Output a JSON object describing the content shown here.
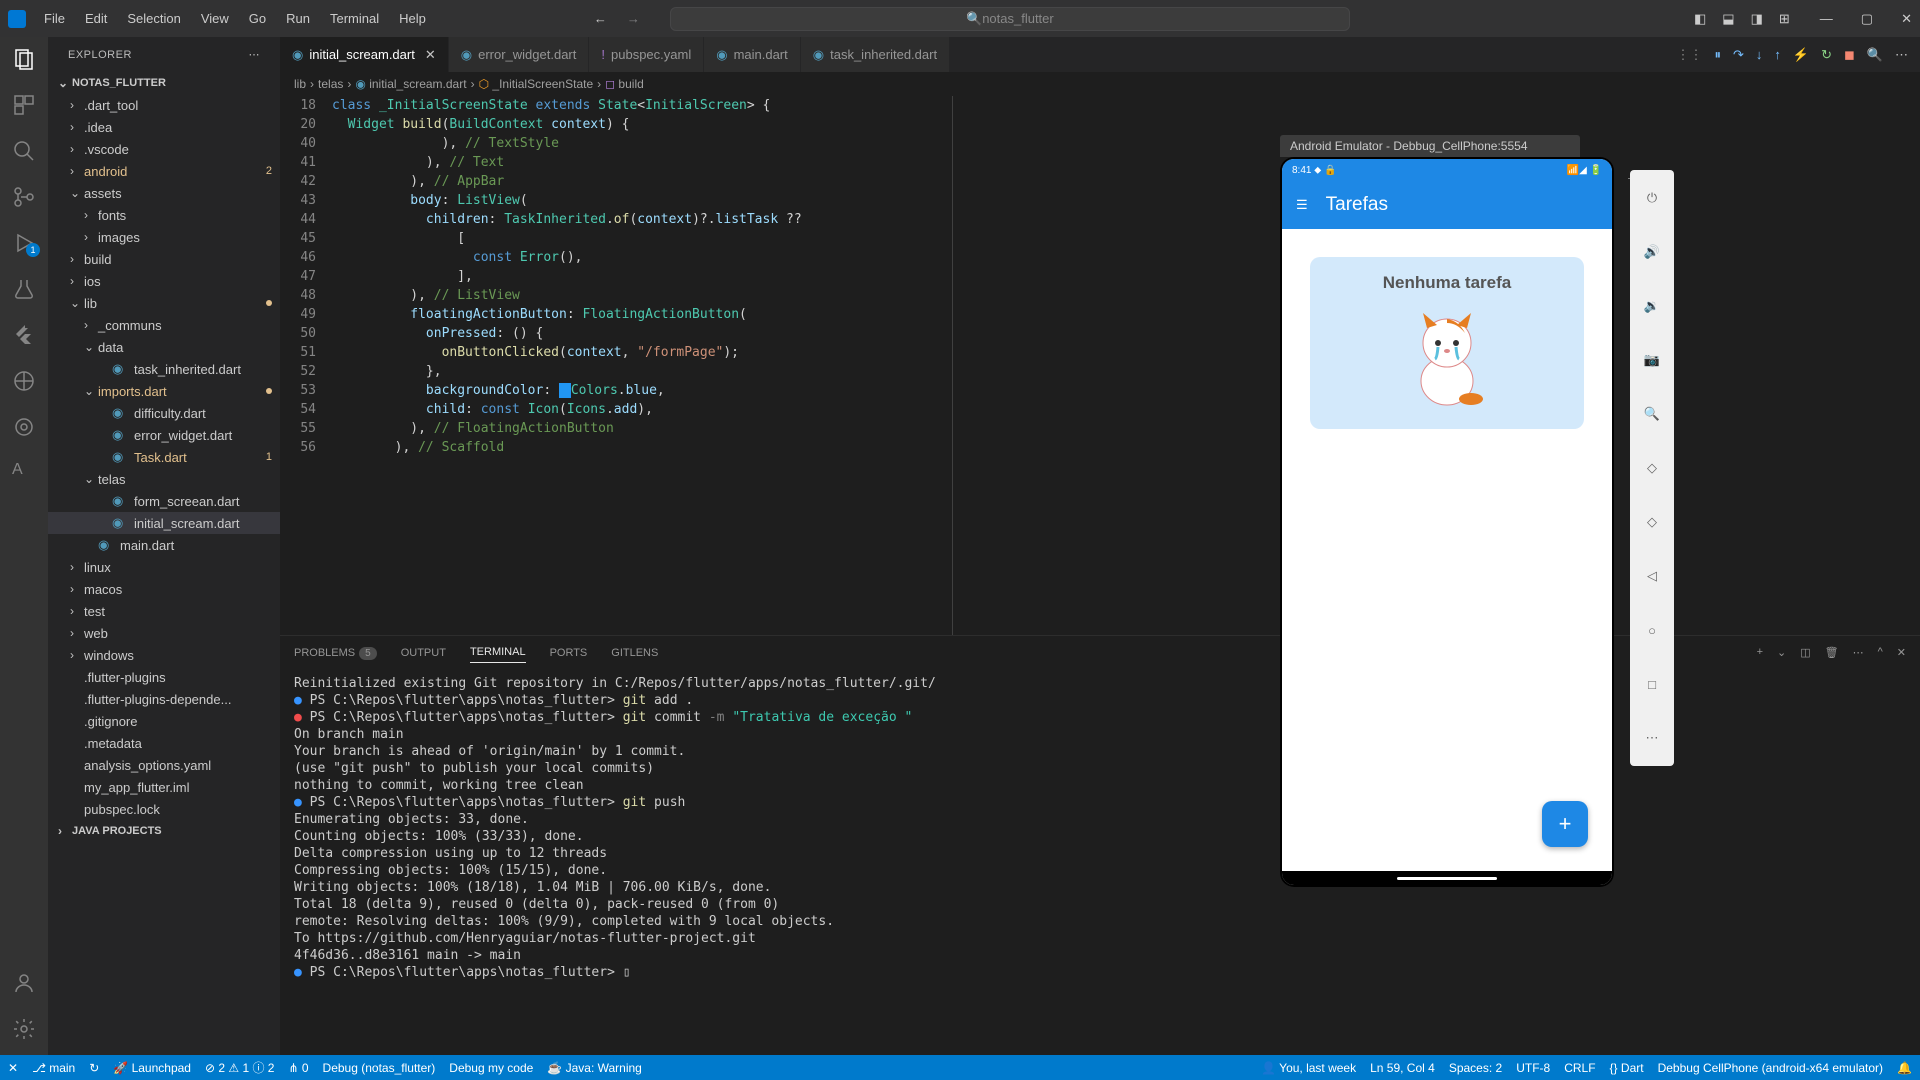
{
  "titlebar": {
    "menu": [
      "File",
      "Edit",
      "Selection",
      "View",
      "Go",
      "Run",
      "Terminal",
      "Help"
    ],
    "search": "notas_flutter"
  },
  "sidebar": {
    "title": "EXPLORER",
    "root": "NOTAS_FLUTTER",
    "items": [
      {
        "label": ".dart_tool",
        "chev": "›",
        "indent": 1
      },
      {
        "label": ".idea",
        "chev": "›",
        "indent": 1
      },
      {
        "label": ".vscode",
        "chev": "›",
        "indent": 1
      },
      {
        "label": "android",
        "chev": "›",
        "indent": 1,
        "mod": true,
        "badge": "2"
      },
      {
        "label": "assets",
        "chev": "⌄",
        "indent": 1
      },
      {
        "label": "fonts",
        "chev": "›",
        "indent": 2
      },
      {
        "label": "images",
        "chev": "›",
        "indent": 2
      },
      {
        "label": "build",
        "chev": "›",
        "indent": 1
      },
      {
        "label": "ios",
        "chev": "›",
        "indent": 1
      },
      {
        "label": "lib",
        "chev": "⌄",
        "indent": 1,
        "dot": true
      },
      {
        "label": "_communs",
        "chev": "›",
        "indent": 2
      },
      {
        "label": "data",
        "chev": "⌄",
        "indent": 2
      },
      {
        "label": "task_inherited.dart",
        "icon": "◉",
        "indent": 3
      },
      {
        "label": "imports.dart",
        "chev": "⌄",
        "indent": 2,
        "mod": true,
        "dot": true
      },
      {
        "label": "difficulty.dart",
        "icon": "◉",
        "indent": 3
      },
      {
        "label": "error_widget.dart",
        "icon": "◉",
        "indent": 3
      },
      {
        "label": "Task.dart",
        "icon": "◉",
        "indent": 3,
        "mod": true,
        "badge": "1"
      },
      {
        "label": "telas",
        "chev": "⌄",
        "indent": 2
      },
      {
        "label": "form_screean.dart",
        "icon": "◉",
        "indent": 3
      },
      {
        "label": "initial_scream.dart",
        "icon": "◉",
        "indent": 3,
        "selected": true
      },
      {
        "label": "main.dart",
        "icon": "◉",
        "indent": 2
      },
      {
        "label": "linux",
        "chev": "›",
        "indent": 1
      },
      {
        "label": "macos",
        "chev": "›",
        "indent": 1
      },
      {
        "label": "test",
        "chev": "›",
        "indent": 1
      },
      {
        "label": "web",
        "chev": "›",
        "indent": 1
      },
      {
        "label": "windows",
        "chev": "›",
        "indent": 1
      },
      {
        "label": ".flutter-plugins",
        "icon": "",
        "indent": 1
      },
      {
        "label": ".flutter-plugins-depende...",
        "icon": "",
        "indent": 1
      },
      {
        "label": ".gitignore",
        "icon": "",
        "indent": 1
      },
      {
        "label": ".metadata",
        "icon": "",
        "indent": 1
      },
      {
        "label": "analysis_options.yaml",
        "icon": "",
        "indent": 1
      },
      {
        "label": "my_app_flutter.iml",
        "icon": "",
        "indent": 1
      },
      {
        "label": "pubspec.lock",
        "icon": "",
        "indent": 1
      }
    ],
    "bottom_section": "JAVA PROJECTS"
  },
  "tabs": [
    {
      "label": "initial_scream.dart",
      "active": true,
      "color": "#519aba"
    },
    {
      "label": "error_widget.dart",
      "color": "#519aba"
    },
    {
      "label": "pubspec.yaml",
      "color": "#a074c4",
      "dot": true
    },
    {
      "label": "main.dart",
      "color": "#519aba"
    },
    {
      "label": "task_inherited.dart",
      "color": "#519aba"
    }
  ],
  "breadcrumb": [
    "lib",
    "telas",
    "initial_scream.dart",
    "_InitialScreenState",
    "build"
  ],
  "gutter": [
    "18",
    "20",
    "40",
    "41",
    "42",
    "43",
    "44",
    "45",
    "46",
    "47",
    "48",
    "49",
    "50",
    "51",
    "52",
    "53",
    "54",
    "55",
    "56"
  ],
  "code_lines": [
    "<span class='kw'>class</span> <span class='cls'>_InitialScreenState</span> <span class='kw'>extends</span> <span class='cls'>State</span><span class='pun'>&lt;</span><span class='cls'>InitialScreen</span><span class='pun'>&gt; {</span>",
    "  <span class='cls'>Widget</span> <span class='fn'>build</span><span class='pun'>(</span><span class='cls'>BuildContext</span> <span class='var'>context</span><span class='pun'>) {</span>",
    "              <span class='pun'>),</span> <span class='cmt'>// TextStyle</span>",
    "            <span class='pun'>),</span> <span class='cmt'>// Text</span>",
    "          <span class='pun'>),</span> <span class='cmt'>// AppBar</span>",
    "          <span class='var'>body</span><span class='pun'>:</span> <span class='cls'>ListView</span><span class='pun'>(</span>",
    "            <span class='var'>children</span><span class='pun'>:</span> <span class='cls'>TaskInherited</span><span class='pun'>.</span><span class='fn'>of</span><span class='pun'>(</span><span class='var'>context</span><span class='pun'>)?.</span><span class='var'>listTask</span> <span class='pun'>??</span>",
    "                <span class='pun'>[</span>",
    "                  <span class='kw'>const</span> <span class='cls'>Error</span><span class='pun'>(),</span>",
    "                <span class='pun'>],</span>",
    "          <span class='pun'>),</span> <span class='cmt'>// ListView</span>",
    "          <span class='var'>floatingActionButton</span><span class='pun'>:</span> <span class='cls'>FloatingActionButton</span><span class='pun'>(</span>",
    "            <span class='var'>onPressed</span><span class='pun'>: () {</span>",
    "              <span class='fn'>onButtonClicked</span><span class='pun'>(</span><span class='var'>context</span><span class='pun'>,</span> <span class='str'>\"/formPage\"</span><span class='pun'>);</span>",
    "            <span class='pun'>},</span>",
    "            <span class='var'>backgroundColor</span><span class='pun'>:</span> <span style='background:#2196f3;padding:0 2px'>&nbsp;</span><span class='cls'>Colors</span><span class='pun'>.</span><span class='var'>blue</span><span class='pun'>,</span>",
    "            <span class='var'>child</span><span class='pun'>:</span> <span class='kw'>const</span> <span class='cls'>Icon</span><span class='pun'>(</span><span class='cls'>Icons</span><span class='pun'>.</span><span class='var'>add</span><span class='pun'>),</span>",
    "          <span class='pun'>),</span> <span class='cmt'>// FloatingActionButton</span>",
    "        <span class='pun'>),</span> <span class='cmt'>// Scaffold</span>"
  ],
  "panel": {
    "tabs": [
      {
        "label": "PROBLEMS",
        "badge": "5"
      },
      {
        "label": "OUTPUT"
      },
      {
        "label": "TERMINAL",
        "active": true
      },
      {
        "label": "PORTS"
      },
      {
        "label": "GITLENS"
      }
    ],
    "terminal_lines": [
      "Reinitialized existing Git repository in C:/Repos/flutter/apps/notas_flutter/.git/",
      "<span class='term-blue-dot'>●</span> PS C:\\Repos\\flutter\\apps\\notas_flutter> <span class='term-yellow'>git</span> add .",
      "<span class='term-red-dot'>●</span> PS C:\\Repos\\flutter\\apps\\notas_flutter> <span class='term-yellow'>git</span> commit <span style='color:#808080'>-m</span> <span style='color:#3dc9b0'>\"Tratativa de exceção \"</span>",
      "On branch main",
      "Your branch is ahead of 'origin/main' by 1 commit.",
      "  (use \"git push\" to publish your local commits)",
      "",
      "nothing to commit, working tree clean",
      "<span class='term-blue-dot'>●</span> PS C:\\Repos\\flutter\\apps\\notas_flutter> <span class='term-yellow'>git</span> push",
      "Enumerating objects: 33, done.",
      "Counting objects: 100% (33/33), done.",
      "Delta compression using up to 12 threads",
      "Compressing objects: 100% (15/15), done.",
      "Writing objects: 100% (18/18), 1.04 MiB | 706.00 KiB/s, done.",
      "Total 18 (delta 9), reused 0 (delta 0), pack-reused 0 (from 0)",
      "remote: Resolving deltas: 100% (9/9), completed with 9 local objects.",
      "To https://github.com/Henryaguiar/notas-flutter-project.git",
      "   4f46d36..d8e3161  main -> main",
      "<span class='term-blue-dot'>●</span> PS C:\\Repos\\flutter\\apps\\notas_flutter> ▯"
    ]
  },
  "statusbar": {
    "left": [
      "✕",
      "⎇ main",
      "↻",
      "🚀 Launchpad",
      "⊘ 2 ⚠ 1 ⓘ 2",
      "⋔ 0",
      "Debug (notas_flutter)",
      "Debug my code",
      "☕ Java: Warning"
    ],
    "right": [
      "👤 You, last week",
      "Ln 59, Col 4",
      "Spaces: 2",
      "UTF-8",
      "CRLF",
      "{} Dart",
      "Debbug CellPhone (android-x64 emulator)",
      "🔔"
    ]
  },
  "emulator": {
    "title": "Android Emulator - Debbug_CellPhone:5554",
    "status_time": "8:41",
    "appbar_title": "Tarefas",
    "card_title": "Nenhuma tarefa",
    "fab": "+"
  }
}
